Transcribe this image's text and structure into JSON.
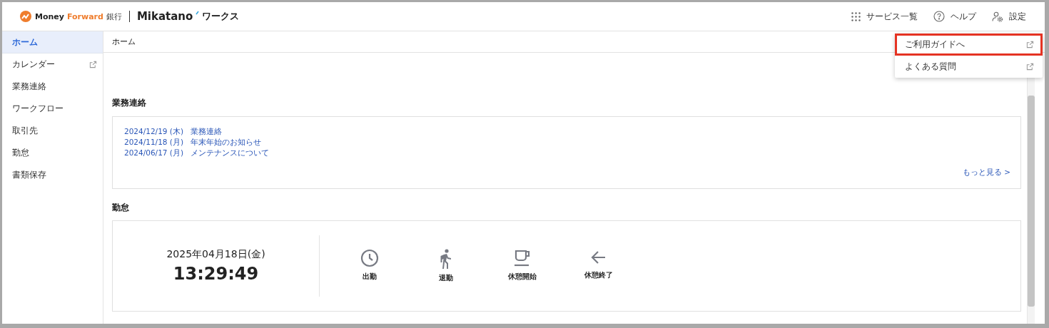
{
  "header": {
    "logo": {
      "brand_part1": "Money",
      "brand_part2": "Forward",
      "brand_suffix": "銀行",
      "product": "Mikatano",
      "product_suffix": "ワークス"
    },
    "actions": [
      {
        "kind": "grid",
        "label": "サービス一覧"
      },
      {
        "kind": "help",
        "label": "ヘルプ"
      },
      {
        "kind": "settings",
        "label": "設定"
      }
    ]
  },
  "sidebar": {
    "items": [
      {
        "label": "ホーム",
        "selected": true,
        "external": false
      },
      {
        "label": "カレンダー",
        "selected": false,
        "external": true
      },
      {
        "label": "業務連絡",
        "selected": false,
        "external": false
      },
      {
        "label": "ワークフロー",
        "selected": false,
        "external": false
      },
      {
        "label": "取引先",
        "selected": false,
        "external": false
      },
      {
        "label": "勤怠",
        "selected": false,
        "external": false
      },
      {
        "label": "書類保存",
        "selected": false,
        "external": false
      }
    ]
  },
  "breadcrumb": "ホーム",
  "help_menu": {
    "items": [
      {
        "label": "ご利用ガイドへ",
        "highlighted": true
      },
      {
        "label": "よくある質問",
        "highlighted": false
      }
    ]
  },
  "notices": {
    "title": "業務連絡",
    "items": [
      {
        "date": "2024/12/19 (木)",
        "subject": "業務連絡"
      },
      {
        "date": "2024/11/18 (月)",
        "subject": "年末年始のお知らせ"
      },
      {
        "date": "2024/06/17 (月)",
        "subject": "メンテナンスについて"
      }
    ],
    "more": "もっと見る >"
  },
  "attendance": {
    "title": "勤怠",
    "date": "2025年04月18日(金)",
    "time": "13:29:49",
    "buttons": [
      {
        "kind": "clock",
        "label": "出勤"
      },
      {
        "kind": "walk",
        "label": "退勤"
      },
      {
        "kind": "cup",
        "label": "休憩開始"
      },
      {
        "kind": "back",
        "label": "休憩終了"
      }
    ]
  }
}
